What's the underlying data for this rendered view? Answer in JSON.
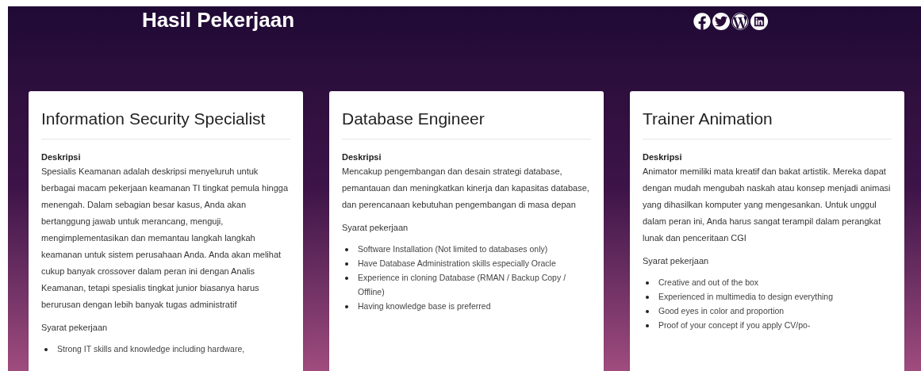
{
  "header": {
    "title": "Hasil Pekerjaan",
    "social_links": [
      {
        "kind": "facebook"
      },
      {
        "kind": "twitter"
      },
      {
        "kind": "wordpress"
      },
      {
        "kind": "linkedin"
      }
    ]
  },
  "cards": [
    {
      "title": "Information Security Specialist",
      "description_label": "Deskripsi",
      "description": "Spesialis Keamanan adalah deskripsi menyeluruh untuk berbagai macam pekerjaan keamanan TI tingkat pemula hingga menengah. Dalam sebagian besar kasus, Anda akan bertanggung jawab untuk merancang, menguji, mengimplementasikan dan memantau langkah langkah keamanan untuk sistem perusahaan Anda. Anda akan melihat cukup banyak crossover dalam peran ini dengan Analis Keamanan, tetapi spesialis tingkat junior biasanya harus berurusan dengan lebih banyak tugas administratif",
      "requirements_label": "Syarat pekerjaan",
      "requirements": [
        "Strong IT skills and knowledge including hardware,"
      ]
    },
    {
      "title": "Database Engineer",
      "description_label": "Deskripsi",
      "description": "Mencakup pengembangan dan desain strategi database, pemantauan dan meningkatkan kinerja dan kapasitas database, dan perencanaan kebutuhan pengembangan di masa depan",
      "requirements_label": "Syarat pekerjaan",
      "requirements": [
        "Software Installation (Not limited to databases only)",
        "Have Database Administration skills especially Oracle",
        "Experience in cloning Database (RMAN / Backup Copy / Offline)",
        "Having knowledge base is preferred"
      ]
    },
    {
      "title": "Trainer Animation",
      "description_label": "Deskripsi",
      "description": "Animator memiliki mata kreatif dan bakat artistik. Mereka dapat dengan mudah mengubah naskah atau konsep menjadi animasi yang dihasilkan komputer yang mengesankan. Untuk unggul dalam peran ini, Anda harus sangat terampil dalam perangkat lunak dan penceritaan CGI",
      "requirements_label": "Syarat pekerjaan",
      "requirements": [
        "Creative and out of the box",
        "Experienced in multimedia to design everything",
        "Good eyes in color and proportion",
        "Proof of your concept if you apply CV/po-"
      ]
    }
  ]
}
